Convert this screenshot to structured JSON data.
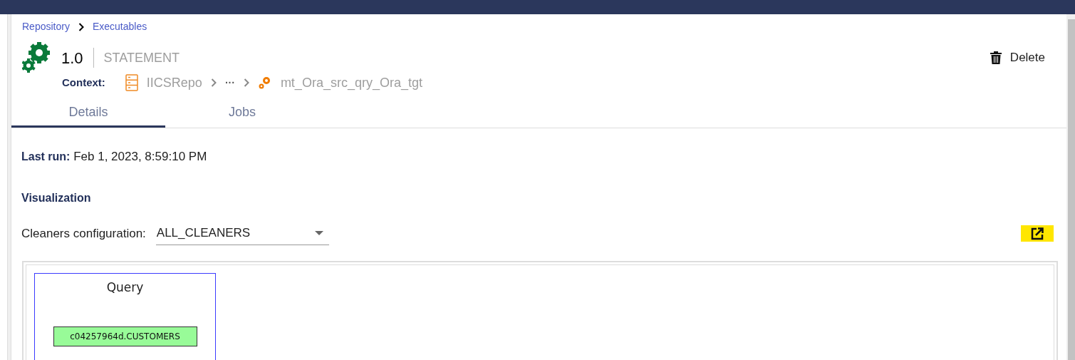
{
  "breadcrumb": [
    {
      "label": "Repository"
    },
    {
      "label": "Executables"
    }
  ],
  "header": {
    "version": "1.0",
    "type": "STATEMENT",
    "delete_label": "Delete"
  },
  "context": {
    "label": "Context:",
    "items": [
      {
        "kind": "repo",
        "label": "IICSRepo"
      },
      {
        "kind": "ellipsis",
        "label": "···"
      },
      {
        "kind": "mapping",
        "label": "mt_Ora_src_qry_Ora_tgt"
      }
    ]
  },
  "tabs": [
    {
      "label": "Details",
      "selected": true
    },
    {
      "label": "Jobs",
      "selected": false
    }
  ],
  "last_run": {
    "label": "Last run:",
    "value": "Feb 1, 2023, 8:59:10 PM"
  },
  "visualization": {
    "title": "Visualization",
    "config_label": "Cleaners configuration:",
    "config_value": "ALL_CLEANERS",
    "diagram": {
      "group_title": "Query",
      "node": "c04257964d.CUSTOMERS"
    }
  }
}
